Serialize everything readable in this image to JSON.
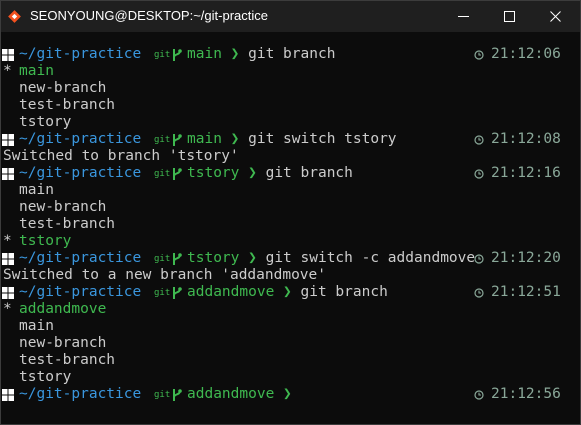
{
  "window": {
    "title": "SEONYOUNG@DESKTOP:~/git-practice"
  },
  "colors": {
    "directory": "#3a96dd",
    "branch": "#3fb950",
    "text": "#cccccc",
    "time": "#8aa899",
    "background": "#0c0c0c"
  },
  "icons": {
    "app": "git-bash-diamond-icon",
    "prompt": "windows-logo-icon",
    "git": "git-icon",
    "branch": "git-branch-icon",
    "time": "clock-icon"
  },
  "prompt": {
    "dir": "~/git-practice",
    "git_glyph": "git",
    "arrow": "❯"
  },
  "session": [
    {
      "branch": "main",
      "command": "git branch",
      "time": "21:12:06"
    },
    {
      "current": "main",
      "others": [
        "new-branch",
        "test-branch",
        "tstory"
      ]
    },
    {
      "branch": "main",
      "command": "git switch tstory",
      "time": "21:12:08"
    },
    {
      "output": "Switched to branch 'tstory'"
    },
    {
      "branch": "tstory",
      "command": "git branch",
      "time": "21:12:16"
    },
    {
      "before": [
        "main",
        "new-branch",
        "test-branch"
      ],
      "current": "tstory"
    },
    {
      "branch": "tstory",
      "command": "git switch -c addandmove",
      "time": "21:12:20"
    },
    {
      "output": "Switched to a new branch 'addandmove'"
    },
    {
      "branch": "addandmove",
      "command": "git branch",
      "time": "21:12:51"
    },
    {
      "current": "addandmove",
      "others": [
        "main",
        "new-branch",
        "test-branch",
        "tstory"
      ]
    },
    {
      "branch": "addandmove",
      "command": "",
      "time": "21:12:56"
    }
  ],
  "current_marker": "*"
}
